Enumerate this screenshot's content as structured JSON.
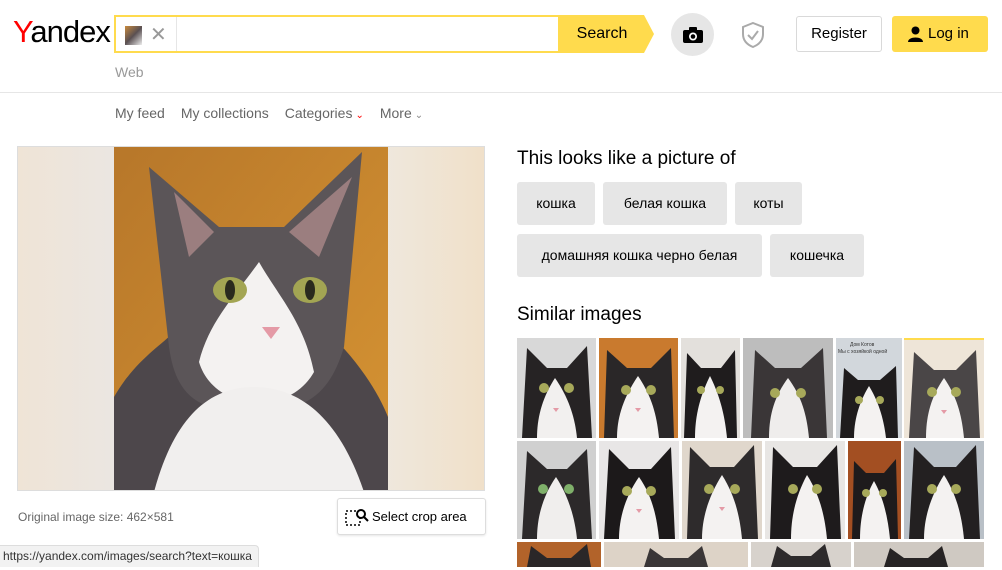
{
  "header": {
    "logo": "Yandex",
    "search_button": "Search",
    "web_tab": "Web",
    "register": "Register",
    "login": "Log in"
  },
  "subnav": {
    "my_feed": "My feed",
    "my_collections": "My collections",
    "categories": "Categories",
    "more": "More"
  },
  "image": {
    "original_size": "Original image size: 462×581",
    "crop_label": "Select crop area"
  },
  "looks_like": {
    "title": "This looks like a picture of",
    "tags": [
      "кошка",
      "белая кошка",
      "коты",
      "домашняя кошка черно белая",
      "кошечка"
    ]
  },
  "similar": {
    "title": "Similar images",
    "thumb_overlay_text": [
      "Дом Котов",
      "Мы с хозяйкой одной"
    ]
  },
  "status_url": "https://yandex.com/images/search?text=кошка",
  "colors": {
    "accent": "#ffdb4d",
    "logo_red": "#ff0000",
    "tag_bg": "#e6e6e6"
  }
}
